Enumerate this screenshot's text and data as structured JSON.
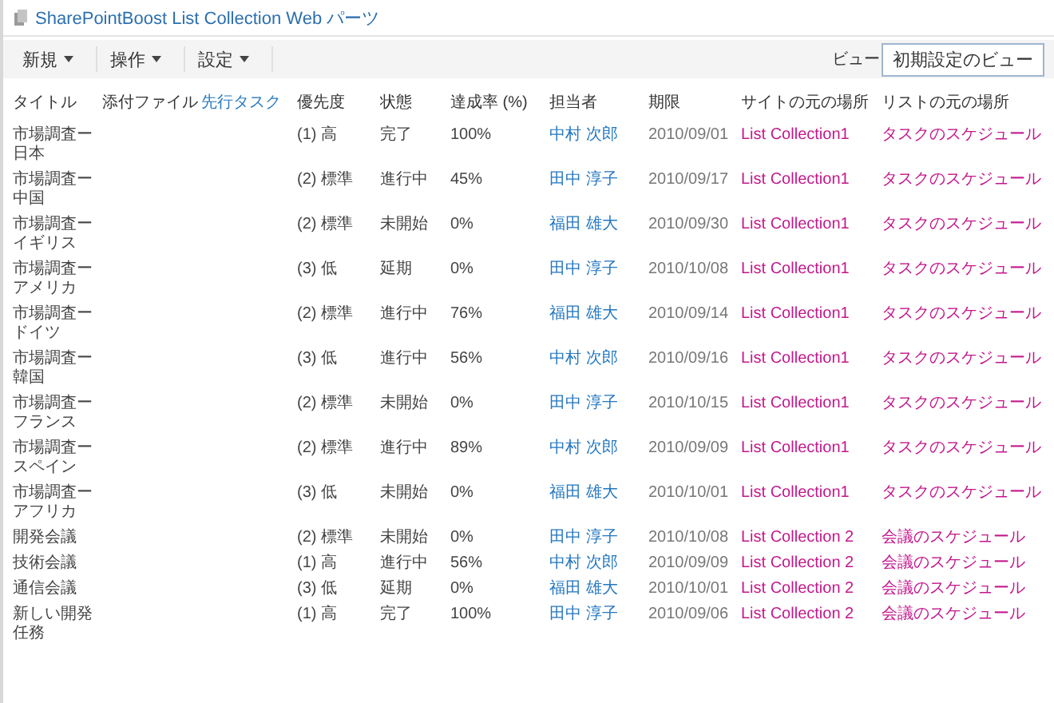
{
  "webpart": {
    "title": "SharePointBoost List Collection Web パーツ"
  },
  "toolbar": {
    "menus": [
      {
        "label": "新規"
      },
      {
        "label": "操作"
      },
      {
        "label": "設定"
      }
    ],
    "view_label": "ビュー",
    "view_button": "初期設定のビュー"
  },
  "table": {
    "columns": [
      {
        "label": "タイトル",
        "kind": "plain"
      },
      {
        "label": "添付ファイル",
        "kind": "plain"
      },
      {
        "label": "先行タスク",
        "kind": "link"
      },
      {
        "label": "優先度",
        "kind": "plain"
      },
      {
        "label": "状態",
        "kind": "plain"
      },
      {
        "label": "達成率 (%)",
        "kind": "plain"
      },
      {
        "label": "担当者",
        "kind": "plain"
      },
      {
        "label": "期限",
        "kind": "plain"
      },
      {
        "label": "サイトの元の場所",
        "kind": "plain"
      },
      {
        "label": "リストの元の場所",
        "kind": "plain"
      }
    ],
    "rows": [
      {
        "title": "市場調査ー日本",
        "priority": "(1) 高",
        "status": "完了",
        "progress": "100%",
        "assignee": "中村 次郎",
        "due": "2010/09/01",
        "site": "List Collection1",
        "list": "タスクのスケジュール"
      },
      {
        "title": "市場調査ー中国",
        "priority": "(2) 標準",
        "status": "進行中",
        "progress": "45%",
        "assignee": "田中 淳子",
        "due": "2010/09/17",
        "site": "List Collection1",
        "list": "タスクのスケジュール"
      },
      {
        "title": "市場調査ーイギリス",
        "priority": "(2) 標準",
        "status": "未開始",
        "progress": "0%",
        "assignee": "福田 雄大",
        "due": "2010/09/30",
        "site": "List Collection1",
        "list": "タスクのスケジュール"
      },
      {
        "title": "市場調査ーアメリカ",
        "priority": "(3) 低",
        "status": "延期",
        "progress": "0%",
        "assignee": "田中 淳子",
        "due": "2010/10/08",
        "site": "List Collection1",
        "list": "タスクのスケジュール"
      },
      {
        "title": "市場調査ードイツ",
        "priority": "(2) 標準",
        "status": "進行中",
        "progress": "76%",
        "assignee": "福田 雄大",
        "due": "2010/09/14",
        "site": "List Collection1",
        "list": "タスクのスケジュール"
      },
      {
        "title": "市場調査ー韓国",
        "priority": "(3) 低",
        "status": "進行中",
        "progress": "56%",
        "assignee": "中村 次郎",
        "due": "2010/09/16",
        "site": "List Collection1",
        "list": "タスクのスケジュール"
      },
      {
        "title": "市場調査ーフランス",
        "priority": "(2) 標準",
        "status": "未開始",
        "progress": "0%",
        "assignee": "田中 淳子",
        "due": "2010/10/15",
        "site": "List Collection1",
        "list": "タスクのスケジュール"
      },
      {
        "title": "市場調査ースペイン",
        "priority": "(2) 標準",
        "status": "進行中",
        "progress": "89%",
        "assignee": "中村 次郎",
        "due": "2010/09/09",
        "site": "List Collection1",
        "list": "タスクのスケジュール"
      },
      {
        "title": "市場調査ーアフリカ",
        "priority": "(3) 低",
        "status": "未開始",
        "progress": "0%",
        "assignee": "福田 雄大",
        "due": "2010/10/01",
        "site": "List Collection1",
        "list": "タスクのスケジュール"
      },
      {
        "title": "開発会議",
        "priority": "(2) 標準",
        "status": "未開始",
        "progress": "0%",
        "assignee": "田中 淳子",
        "due": "2010/10/08",
        "site": "List Collection 2",
        "list": "会議のスケジュール"
      },
      {
        "title": "技術会議",
        "priority": "(1) 高",
        "status": "進行中",
        "progress": "56%",
        "assignee": "中村 次郎",
        "due": "2010/09/09",
        "site": "List Collection 2",
        "list": "会議のスケジュール"
      },
      {
        "title": "通信会議",
        "priority": "(3) 低",
        "status": "延期",
        "progress": "0%",
        "assignee": "福田 雄大",
        "due": "2010/10/01",
        "site": "List Collection 2",
        "list": "会議のスケジュール"
      },
      {
        "title": "新しい開発任務",
        "priority": "(1) 高",
        "status": "完了",
        "progress": "100%",
        "assignee": "田中 淳子",
        "due": "2010/09/06",
        "site": "List Collection 2",
        "list": "会議のスケジュール"
      }
    ]
  }
}
